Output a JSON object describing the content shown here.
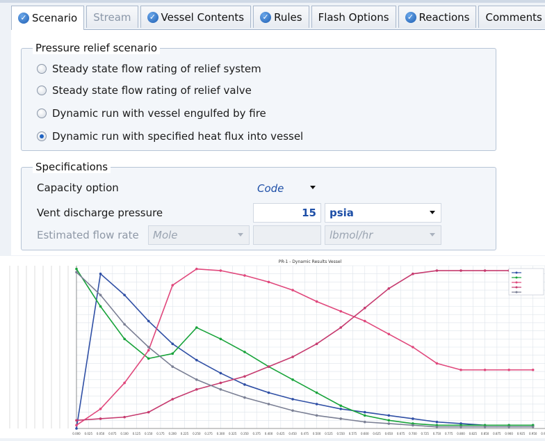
{
  "tabs": [
    {
      "label": "Scenario",
      "icon": "check-circle-icon",
      "active": true
    },
    {
      "label": "Stream",
      "disabled": true
    },
    {
      "label": "Vessel Contents",
      "icon": "check-circle-icon"
    },
    {
      "label": "Rules",
      "icon": "check-circle-icon"
    },
    {
      "label": "Flash Options"
    },
    {
      "label": "Reactions",
      "icon": "check-circle-icon"
    },
    {
      "label": "Comments"
    }
  ],
  "scenario_group": {
    "title": "Pressure relief scenario",
    "options": [
      {
        "label": "Steady state flow rating of relief system",
        "selected": false
      },
      {
        "label": "Steady state flow rating of relief valve",
        "selected": false
      },
      {
        "label": "Dynamic run with vessel engulfed by fire",
        "selected": false
      },
      {
        "label": "Dynamic run with specified heat flux into vessel",
        "selected": true
      }
    ]
  },
  "specifications": {
    "title": "Specifications",
    "capacity_option": {
      "label": "Capacity option",
      "value": "Code"
    },
    "vent_pressure": {
      "label": "Vent discharge pressure",
      "value": "15",
      "unit": "psia"
    },
    "flow_rate": {
      "label": "Estimated flow rate",
      "basis": "Mole",
      "value": "",
      "unit": "lbmol/hr"
    }
  },
  "chart_data": {
    "type": "line",
    "title": "PR-1 - Dynamic Results Vessel",
    "x": [
      0.0,
      0.05,
      0.1,
      0.15,
      0.2,
      0.25,
      0.3,
      0.35,
      0.4,
      0.45,
      0.5,
      0.55,
      0.6,
      0.65,
      0.7,
      0.75,
      0.8,
      0.85,
      0.9,
      0.95
    ],
    "x_ticks": [
      "0.000",
      "0.025",
      "0.050",
      "0.075",
      "0.100",
      "0.125",
      "0.150",
      "0.175",
      "0.200",
      "0.225",
      "0.250",
      "0.275",
      "0.300",
      "0.325",
      "0.350",
      "0.375",
      "0.400",
      "0.425",
      "0.450",
      "0.475",
      "0.500",
      "0.525",
      "0.550",
      "0.575",
      "0.600",
      "0.625",
      "0.650",
      "0.675",
      "0.700",
      "0.725",
      "0.750",
      "0.775",
      "0.800",
      "0.825",
      "0.850",
      "0.875",
      "0.900",
      "0.925",
      "0.950",
      "0.975"
    ],
    "xlim": [
      0,
      0.975
    ],
    "ylim": [
      0,
      1
    ],
    "grid": true,
    "legend_position": "top-right",
    "series": [
      {
        "color": "#2f4fa5",
        "values": [
          0.0,
          0.95,
          0.82,
          0.66,
          0.52,
          0.42,
          0.34,
          0.27,
          0.22,
          0.18,
          0.15,
          0.12,
          0.1,
          0.08,
          0.06,
          0.04,
          0.03,
          0.02,
          0.02,
          0.02
        ]
      },
      {
        "color": "#18a33a",
        "values": [
          0.98,
          0.75,
          0.55,
          0.43,
          0.46,
          0.62,
          0.55,
          0.47,
          0.38,
          0.3,
          0.22,
          0.14,
          0.08,
          0.05,
          0.03,
          0.02,
          0.02,
          0.02,
          0.02,
          0.02
        ]
      },
      {
        "color": "#e0487c",
        "values": [
          0.02,
          0.12,
          0.28,
          0.48,
          0.88,
          0.98,
          0.97,
          0.94,
          0.9,
          0.85,
          0.78,
          0.72,
          0.66,
          0.58,
          0.5,
          0.4,
          0.36,
          0.36,
          0.36,
          0.36
        ]
      },
      {
        "color": "#c63b6f",
        "values": [
          0.05,
          0.06,
          0.07,
          0.1,
          0.18,
          0.24,
          0.28,
          0.32,
          0.38,
          0.44,
          0.52,
          0.62,
          0.74,
          0.86,
          0.95,
          0.97,
          0.97,
          0.97,
          0.97,
          0.97
        ]
      },
      {
        "color": "#7a7f94",
        "values": [
          0.96,
          0.82,
          0.64,
          0.5,
          0.38,
          0.3,
          0.24,
          0.19,
          0.15,
          0.11,
          0.08,
          0.06,
          0.04,
          0.03,
          0.02,
          0.01,
          0.01,
          0.01,
          0.01,
          0.01
        ]
      }
    ]
  }
}
